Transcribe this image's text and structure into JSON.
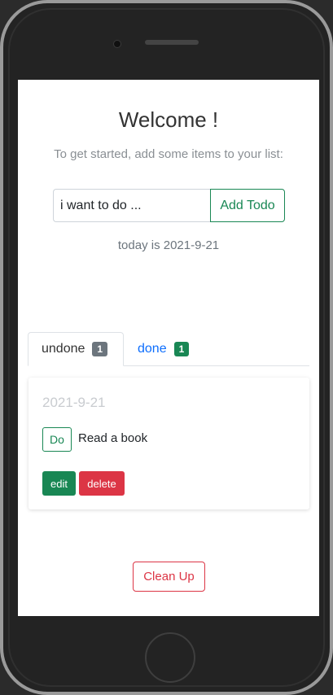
{
  "header": {
    "title": "Welcome !",
    "subtitle": "To get started, add some items to your list:"
  },
  "add_form": {
    "input_value": "i want to do ...",
    "add_button_label": "Add Todo"
  },
  "today_text": "today is 2021-9-21",
  "tabs": [
    {
      "label": "undone",
      "count": "1",
      "active": true,
      "badge_color": "#6c757d"
    },
    {
      "label": "done",
      "count": "1",
      "active": false,
      "badge_color": "#198754"
    }
  ],
  "todos": [
    {
      "date": "2021-9-21",
      "do_button_label": "Do",
      "text": "Read a book",
      "edit_label": "edit",
      "delete_label": "delete"
    }
  ],
  "footer": {
    "cleanup_label": "Clean Up"
  },
  "colors": {
    "success": "#198754",
    "danger": "#dc3545",
    "link": "#0d6efd",
    "secondary": "#6c757d"
  }
}
